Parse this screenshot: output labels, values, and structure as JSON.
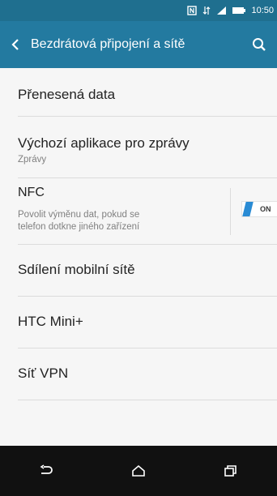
{
  "status_bar": {
    "time": "10:50",
    "icons": [
      "nfc-icon",
      "data-arrows-icon",
      "signal-icon",
      "battery-icon"
    ]
  },
  "app_bar": {
    "title": "Bezdrátová připojení a sítě",
    "back_icon": "chevron-left-icon",
    "search_icon": "search-icon"
  },
  "settings": {
    "items": [
      {
        "title": "Přenesená data"
      },
      {
        "title": "Výchozí aplikace pro zprávy",
        "subtitle": "Zprávy"
      },
      {
        "title": "NFC",
        "subtitle_line1": "Povolit výměnu dat, pokud se",
        "subtitle_line2": "telefon dotkne jiného zařízení",
        "toggle": "ON"
      },
      {
        "title": "Sdílení mobilní sítě"
      },
      {
        "title": "HTC Mini+"
      },
      {
        "title": "Síť VPN"
      }
    ]
  },
  "nav_bar": {
    "buttons": [
      "back-icon",
      "home-icon",
      "recent-apps-icon"
    ]
  },
  "colors": {
    "status_bar": "#1f6f8f",
    "app_bar": "#237aa0",
    "toggle_accent": "#2a8bd4",
    "nav_bar": "#111111"
  }
}
